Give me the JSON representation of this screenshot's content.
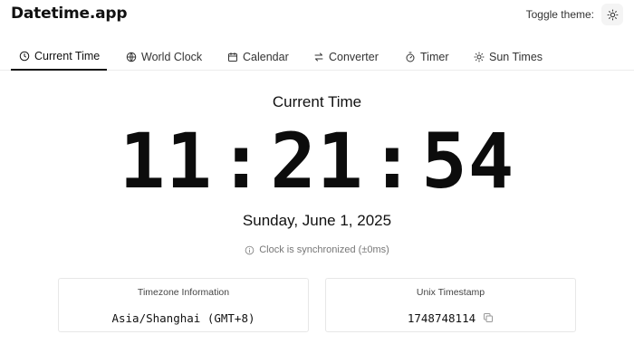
{
  "header": {
    "app_title": "Datetime.app",
    "theme_toggle_label": "Toggle theme:",
    "theme_icon": "sun-icon"
  },
  "tabs": [
    {
      "label": "Current Time",
      "icon": "clock-icon",
      "active": true
    },
    {
      "label": "World Clock",
      "icon": "globe-icon",
      "active": false
    },
    {
      "label": "Calendar",
      "icon": "calendar-icon",
      "active": false
    },
    {
      "label": "Converter",
      "icon": "swap-arrows-icon",
      "active": false
    },
    {
      "label": "Timer",
      "icon": "stopwatch-icon",
      "active": false
    },
    {
      "label": "Sun Times",
      "icon": "sun-icon",
      "active": false
    }
  ],
  "main": {
    "section_title": "Current Time",
    "clock": {
      "hours": "11",
      "minutes": "21",
      "seconds": "54",
      "separator": ":"
    },
    "date": "Sunday, June 1, 2025",
    "sync_status": "Clock is synchronized (±0ms)"
  },
  "cards": {
    "timezone": {
      "label": "Timezone Information",
      "value": "Asia/Shanghai (GMT+8)"
    },
    "unix": {
      "label": "Unix Timestamp",
      "value": "1748748114",
      "copy_icon": "copy-icon"
    }
  },
  "colors": {
    "text": "#111111",
    "muted": "#777777",
    "border": "#e7e7e7",
    "background": "#ffffff"
  }
}
